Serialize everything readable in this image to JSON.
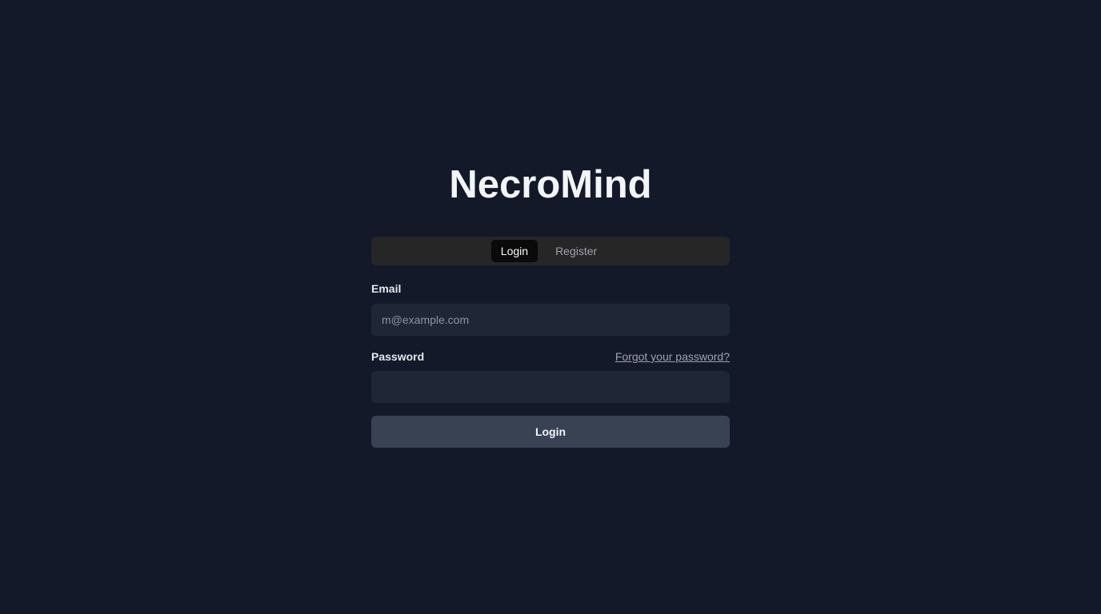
{
  "app": {
    "title": "NecroMind"
  },
  "tabs": [
    {
      "label": "Login",
      "active": true
    },
    {
      "label": "Register",
      "active": false
    }
  ],
  "form": {
    "email_label": "Email",
    "email_placeholder": "m@example.com",
    "email_value": "",
    "password_label": "Password",
    "password_value": "",
    "forgot_link": "Forgot your password?",
    "submit_label": "Login"
  },
  "colors": {
    "background": "#131929",
    "tabs_background": "#262626",
    "active_tab_background": "#0a0a0a",
    "input_background": "#1f2737",
    "button_background": "#394253"
  }
}
